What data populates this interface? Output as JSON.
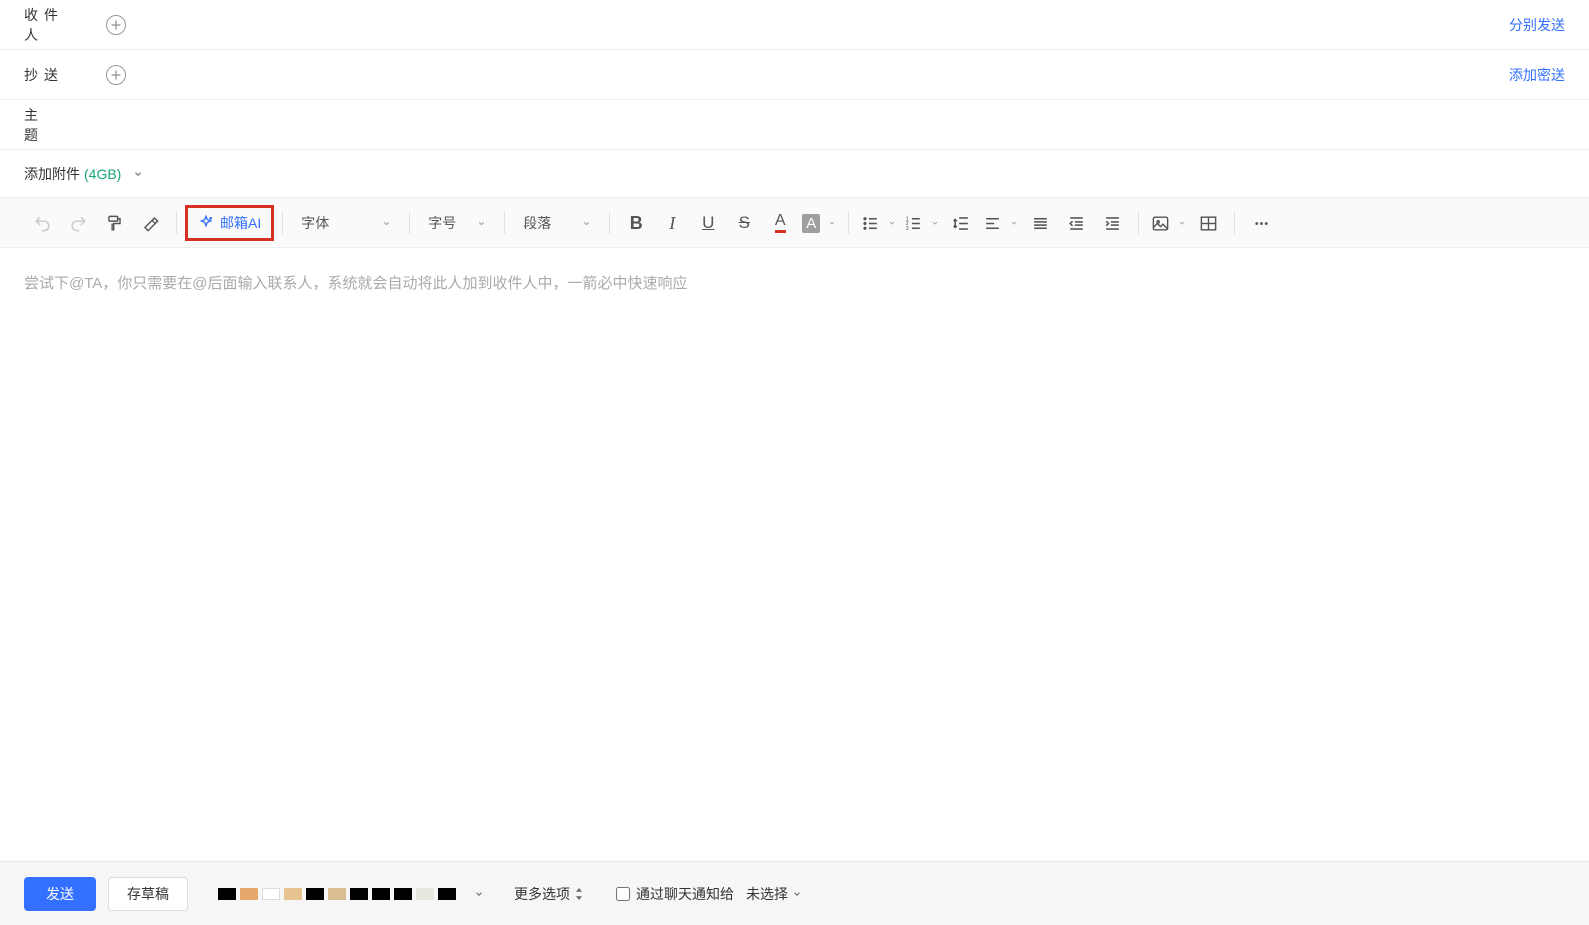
{
  "fields": {
    "recipient_label": "收件人",
    "cc_label": "抄送",
    "subject_label": "主题",
    "separate_send": "分别发送",
    "add_bcc": "添加密送"
  },
  "attachment": {
    "label": "添加附件",
    "size": "(4GB)"
  },
  "toolbar": {
    "ai_label": "邮箱AI",
    "font_label": "字体",
    "fontsize_label": "字号",
    "paragraph_label": "段落"
  },
  "editor": {
    "placeholder": "尝试下@TA，你只需要在@后面输入联系人，系统就会自动将此人加到收件人中，一箭必中快速响应"
  },
  "footer": {
    "send": "发送",
    "draft": "存草稿",
    "more_options": "更多选项",
    "notify_label": "通过聊天通知给",
    "not_selected": "未选择",
    "swatches": [
      "#000000",
      "#e6a96b",
      "#ffffff",
      "#e6c38f",
      "#000000",
      "#d9be93",
      "#000000",
      "#000000",
      "#000000",
      "#e8e8e0",
      "#000000"
    ]
  }
}
